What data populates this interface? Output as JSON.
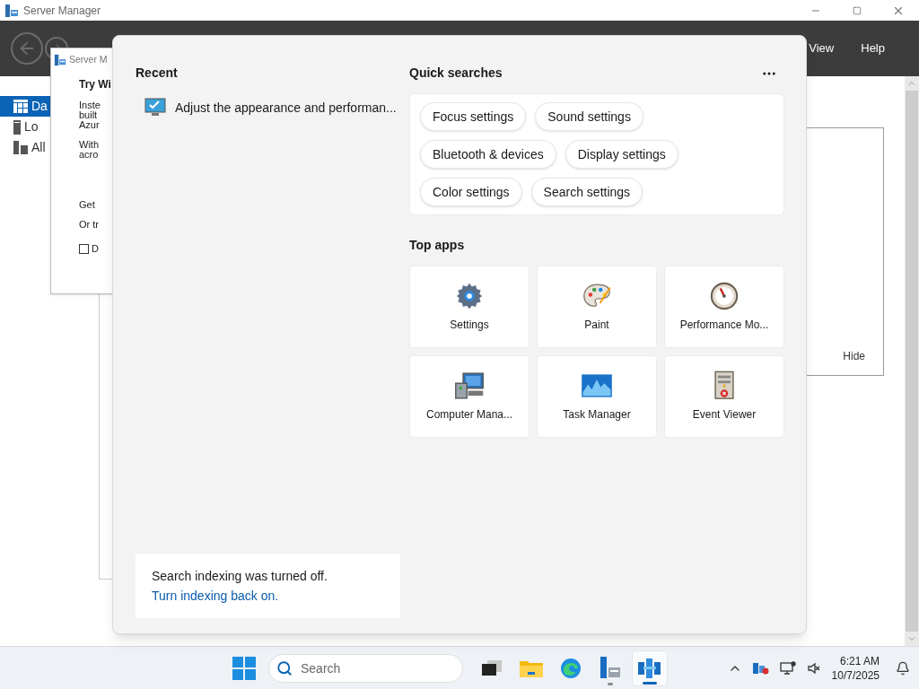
{
  "window": {
    "title": "Server Manager",
    "menu": [
      "View",
      "Help"
    ]
  },
  "sidebar": {
    "items": [
      {
        "label": "Da",
        "kind": "dashboard",
        "selected": true
      },
      {
        "label": "Lo",
        "kind": "local",
        "selected": false
      },
      {
        "label": "All",
        "kind": "all",
        "selected": false
      }
    ]
  },
  "tile_panel": {
    "button": "Hide"
  },
  "dialog": {
    "title": "Server M",
    "heading": "Try Wi",
    "paragraph_1": [
      "Inste",
      "built",
      "Azur"
    ],
    "paragraph_2": [
      "With",
      "acro"
    ],
    "line_1": "Get",
    "line_2": "Or tr",
    "checkbox": {
      "label": "D",
      "checked": false
    }
  },
  "search_flyout": {
    "recent": {
      "title": "Recent",
      "items": [
        "Adjust the appearance and performan..."
      ]
    },
    "quick_searches": {
      "title": "Quick searches",
      "rows": [
        [
          "Focus settings",
          "Sound settings"
        ],
        [
          "Bluetooth & devices",
          "Display settings"
        ],
        [
          "Color settings",
          "Search settings"
        ]
      ]
    },
    "top_apps": {
      "title": "Top apps",
      "apps": [
        {
          "label": "Settings",
          "kind": "settings"
        },
        {
          "label": "Paint",
          "kind": "paint"
        },
        {
          "label": "Performance Mo...",
          "kind": "performance"
        },
        {
          "label": "Computer Mana...",
          "kind": "computer"
        },
        {
          "label": "Task Manager",
          "kind": "taskmanager"
        },
        {
          "label": "Event Viewer",
          "kind": "eventviewer"
        }
      ]
    },
    "notice": {
      "text": "Search indexing was turned off.",
      "link": "Turn indexing back on."
    }
  },
  "taskbar": {
    "search_placeholder": "Search",
    "apps": [
      {
        "kind": "taskview",
        "running": false,
        "selected": false
      },
      {
        "kind": "explorer",
        "running": false,
        "selected": false
      },
      {
        "kind": "edge",
        "running": false,
        "selected": false
      },
      {
        "kind": "servermanager",
        "running": true,
        "selected": false
      },
      {
        "kind": "search",
        "running": true,
        "selected": true
      }
    ],
    "time": "6:21 AM",
    "date": "10/7/2025"
  }
}
